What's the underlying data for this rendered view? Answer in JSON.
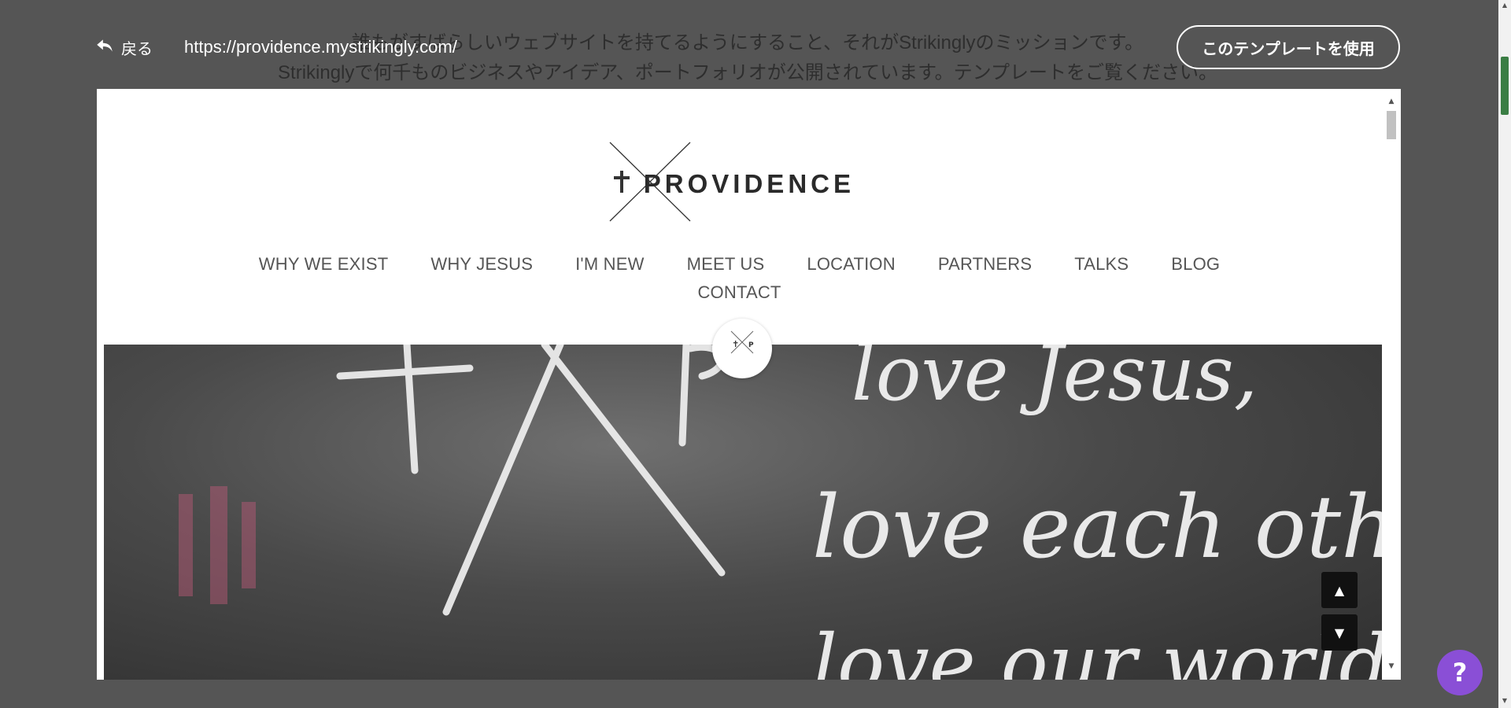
{
  "background": {
    "line1": "誰もがすばらしいウェブサイトを持てるようにすること、それがStrikinglyのミッションです。",
    "line2": "Strikinglyで何千ものビジネスやアイデア、ポートフォリオが公開されています。テンプレートをご覧ください。"
  },
  "toolbar": {
    "back_label": "戻る",
    "url": "https://providence.mystrikingly.com/",
    "use_template_label": "このテンプレートを使用"
  },
  "site": {
    "logo_text": "PROVIDENCE",
    "nav": [
      "WHY WE EXIST",
      "WHY JESUS",
      "I'M NEW",
      "MEET US",
      "LOCATION",
      "PARTNERS",
      "TALKS",
      "BLOG",
      "CONTACT"
    ],
    "badge_left": "✝",
    "badge_right": "P"
  },
  "hero": {
    "chalk_line1": "love Jesus,",
    "chalk_line2": "love each other,",
    "chalk_line3": "love our world"
  },
  "help_label": "?",
  "colors": {
    "help": "#8a4fd6",
    "scroll_thumb": "#3a7d44"
  }
}
